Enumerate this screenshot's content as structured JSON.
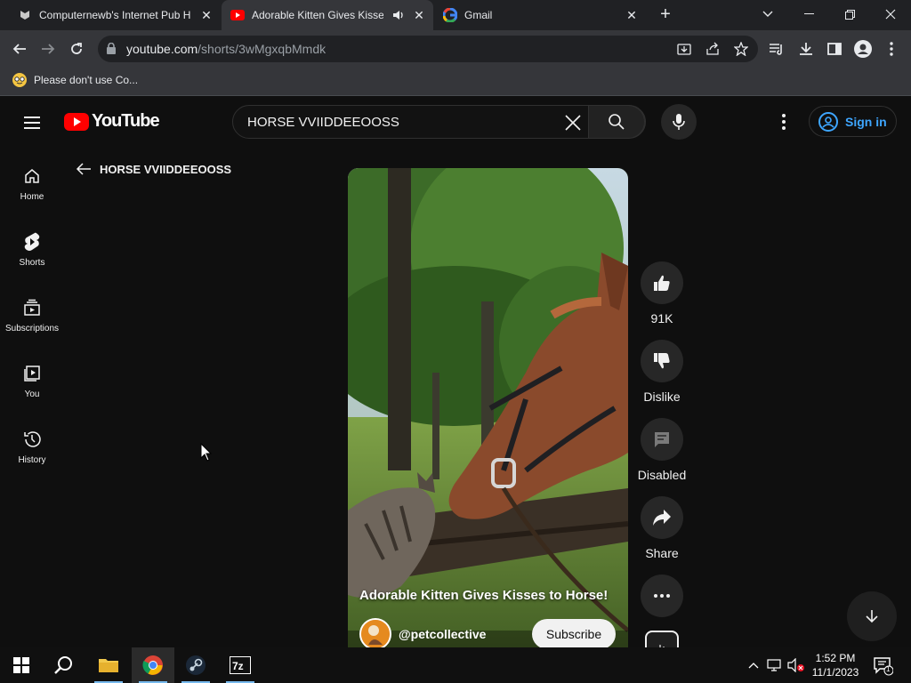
{
  "browser": {
    "tabs": [
      {
        "title": "Computernewb's Internet Pub H",
        "active": false
      },
      {
        "title": "Adorable Kitten Gives Kisses",
        "active": true
      },
      {
        "title": "Gmail",
        "active": false
      }
    ],
    "url_host": "youtube.com",
    "url_path": "/shorts/3wMgxqbMmdk",
    "bookmark": "Please don't use Co..."
  },
  "youtube": {
    "logo_text": "YouTube",
    "search_query": "HORSE VVIIDDEEOOSS",
    "sign_in_label": "Sign in",
    "guide": [
      {
        "label": "Home",
        "icon": "home-icon"
      },
      {
        "label": "Shorts",
        "icon": "shorts-icon"
      },
      {
        "label": "Subscriptions",
        "icon": "subscriptions-icon"
      },
      {
        "label": "You",
        "icon": "you-icon"
      },
      {
        "label": "History",
        "icon": "history-icon"
      }
    ],
    "back_title": "HORSE VVIIDDEEOOSS",
    "short": {
      "title": "Adorable Kitten Gives Kisses to Horse!",
      "channel": "@petcollective",
      "subscribe_label": "Subscribe"
    },
    "actions": {
      "like_count": "91K",
      "dislike_label": "Dislike",
      "comments_label": "Disabled",
      "share_label": "Share"
    }
  },
  "taskbar": {
    "time": "1:52 PM",
    "date": "11/1/2023",
    "notification_count": "1"
  },
  "colors": {
    "yt_red": "#ff0000",
    "link_blue": "#3ea6ff",
    "bg": "#0f0f0f"
  }
}
